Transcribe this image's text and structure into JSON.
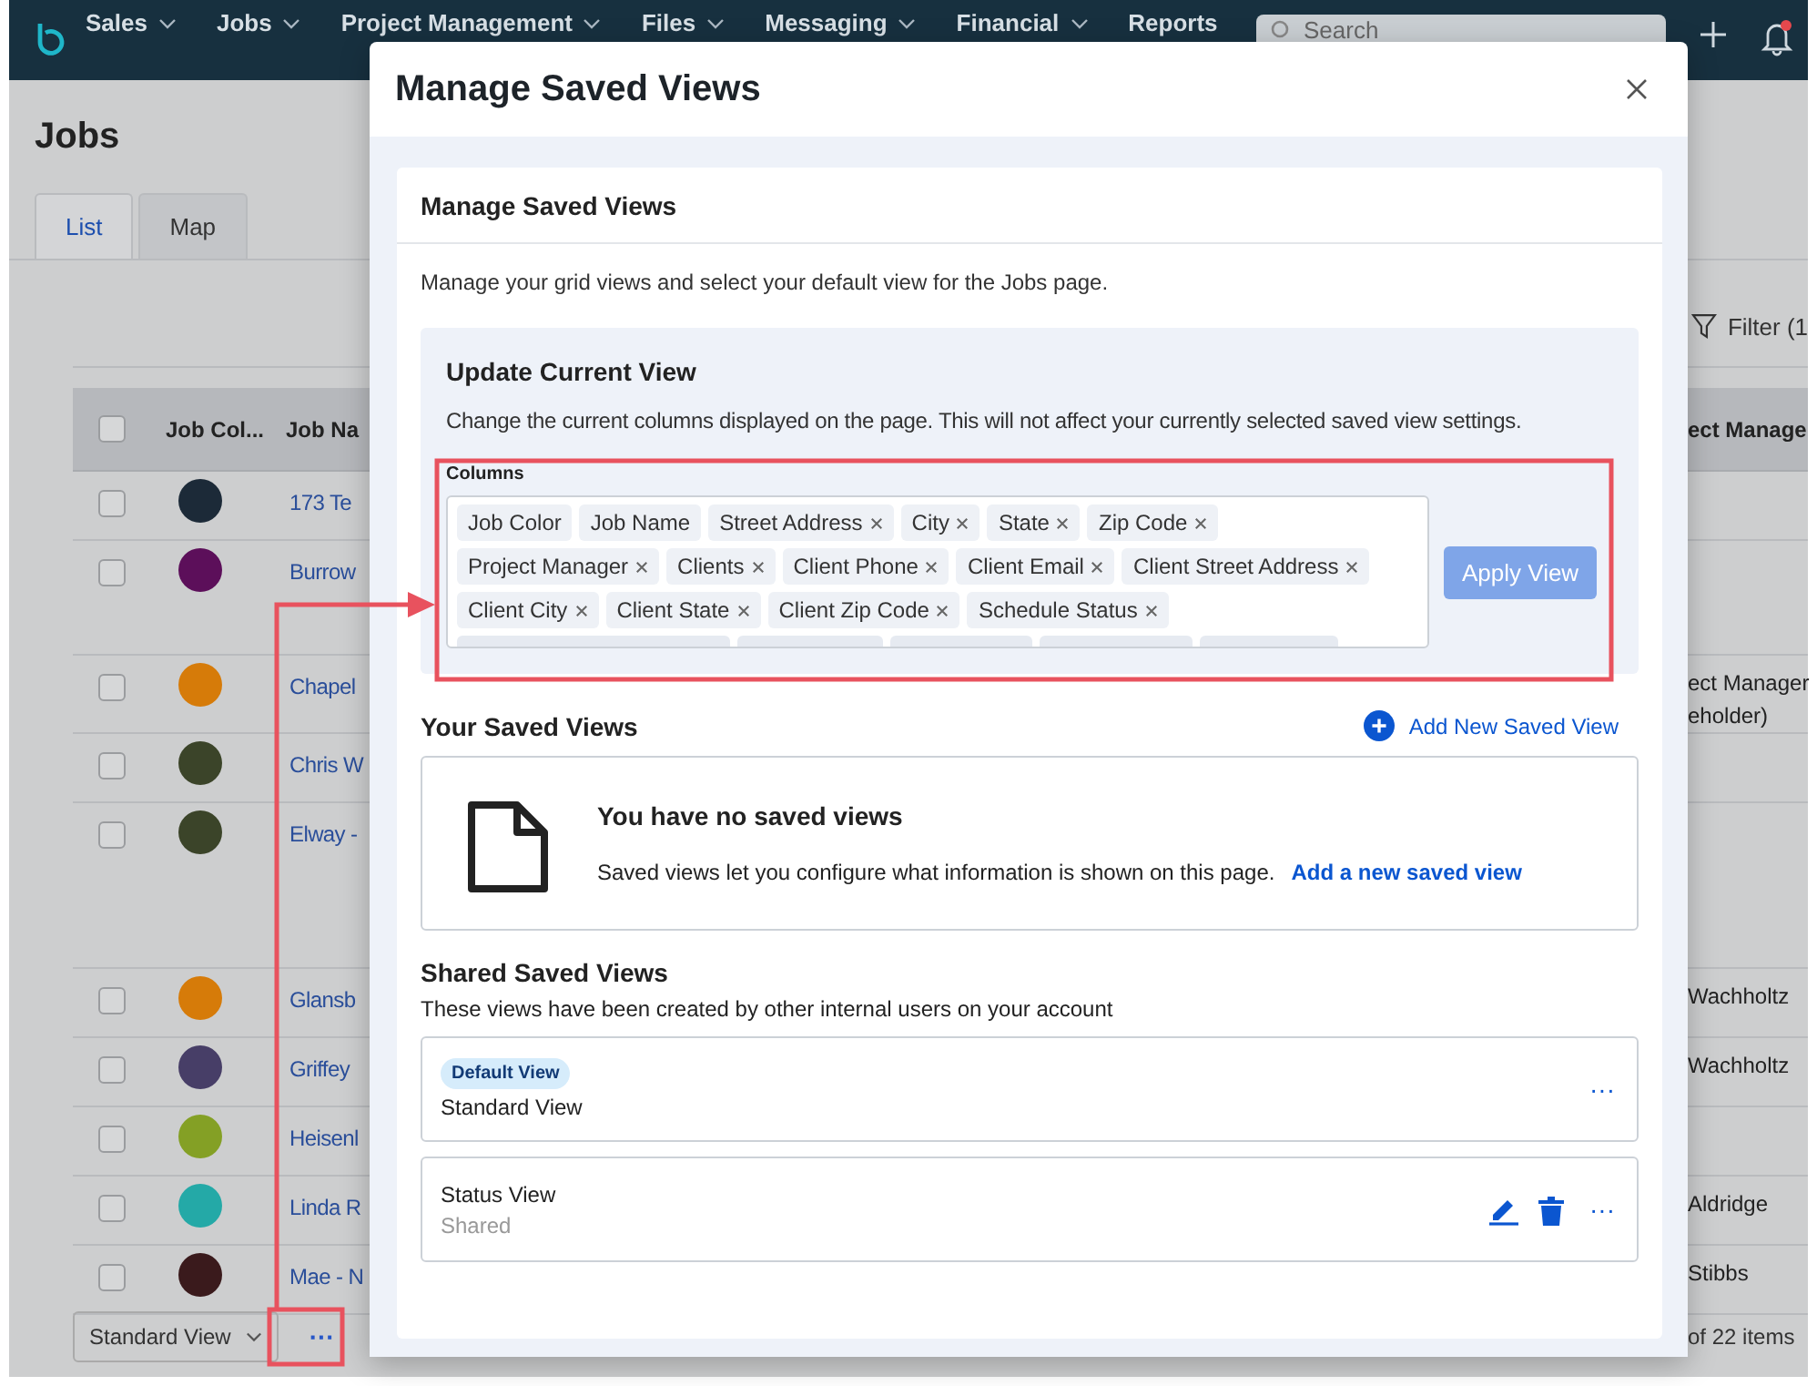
{
  "nav": {
    "items": [
      {
        "label": "Sales",
        "menu": true
      },
      {
        "label": "Jobs",
        "menu": true
      },
      {
        "label": "Project Management",
        "menu": true
      },
      {
        "label": "Files",
        "menu": true
      },
      {
        "label": "Messaging",
        "menu": true
      },
      {
        "label": "Financial",
        "menu": true
      },
      {
        "label": "Reports",
        "menu": false
      }
    ],
    "search": {
      "placeholder": "Search"
    },
    "notifications": {
      "unread": true
    }
  },
  "page": {
    "title": "Jobs",
    "tabs": [
      {
        "label": "List",
        "selected": true
      },
      {
        "label": "Map",
        "selected": false
      }
    ],
    "filter": "Filter (1",
    "table": {
      "select_all_checked": false,
      "columns": [
        "Job Col...",
        "Job Na",
        "ect Manage"
      ],
      "rows": [
        {
          "checked": false,
          "color": "#1c2a38",
          "name": "173 Te",
          "manager": []
        },
        {
          "checked": false,
          "color": "#5c0f5a",
          "name": "Burrow",
          "manager": []
        },
        {
          "checked": false,
          "color": "#d67b09",
          "name": "Chapel",
          "manager": [
            "ect Manager",
            "eholder)"
          ]
        },
        {
          "checked": false,
          "color": "#3b4429",
          "name": "Chris W",
          "manager": []
        },
        {
          "checked": false,
          "color": "#3b4429",
          "name": "Elway -",
          "manager": []
        },
        {
          "checked": false,
          "color": "#d67b09",
          "name": "Glansb",
          "manager": [
            "Wachholtz"
          ]
        },
        {
          "checked": false,
          "color": "#473e67",
          "name": "Griffey",
          "manager": [
            "Wachholtz"
          ]
        },
        {
          "checked": false,
          "color": "#84a025",
          "name": "Heisenl",
          "manager": []
        },
        {
          "checked": false,
          "color": "#24a9a7",
          "name": "Linda R",
          "manager": [
            "Aldridge"
          ]
        },
        {
          "checked": false,
          "color": "#3a1a1c",
          "name": "Mae - N",
          "manager": [
            "Stibbs"
          ]
        }
      ]
    },
    "footer": {
      "view_select": "Standard View",
      "more": "···",
      "count": "of 22 items"
    }
  },
  "modal": {
    "title": "Manage Saved Views",
    "card_title": "Manage Saved Views",
    "description": "Manage your grid views and select your default view for the Jobs page.",
    "update": {
      "title": "Update Current View",
      "description": "Change the current columns displayed on the page. This will not affect your currently selected saved view settings.",
      "field_label": "Columns",
      "chips": [
        {
          "kind": "tag",
          "label": "Job Color",
          "removable": false
        },
        {
          "kind": "tag",
          "label": "Job Name",
          "removable": false
        },
        {
          "kind": "tag",
          "label": "Street Address",
          "removable": true
        },
        {
          "kind": "tag",
          "label": "City",
          "removable": true
        },
        {
          "kind": "tag",
          "label": "State",
          "removable": true
        },
        {
          "kind": "tag",
          "label": "Zip Code",
          "removable": true
        },
        {
          "kind": "tag",
          "label": "Project Manager",
          "removable": true
        },
        {
          "kind": "tag",
          "label": "Clients",
          "removable": true
        },
        {
          "kind": "tag",
          "label": "Client Phone",
          "removable": true
        },
        {
          "kind": "tag",
          "label": "Client Email",
          "removable": true
        },
        {
          "kind": "tag",
          "label": "Client Street Address",
          "removable": true
        },
        {
          "kind": "tag",
          "label": "Client City",
          "removable": true
        },
        {
          "kind": "tag",
          "label": "Client State",
          "removable": true
        },
        {
          "kind": "tag",
          "label": "Client Zip Code",
          "removable": true
        },
        {
          "kind": "tag",
          "label": "Schedule Status",
          "removable": true
        },
        {
          "kind": "hidden"
        },
        {
          "kind": "hidden"
        },
        {
          "kind": "hidden"
        },
        {
          "kind": "hidden"
        },
        {
          "kind": "hidden"
        }
      ],
      "apply": {
        "label": "Apply View",
        "disabled": true
      }
    },
    "yours": {
      "title": "Your Saved Views",
      "add": "Add New Saved View",
      "empty_title": "You have no saved views",
      "empty_text": "Saved views let you configure what information is shown on this page.",
      "empty_link": "Add a new saved view"
    },
    "shared": {
      "title": "Shared Saved Views",
      "subtitle": "These views have been created by other internal users on your account",
      "views": [
        {
          "badge": "Default View",
          "name": "Standard View",
          "editable": false
        },
        {
          "name": "Status View",
          "note": "Shared",
          "editable": true
        }
      ],
      "more": "···"
    }
  }
}
